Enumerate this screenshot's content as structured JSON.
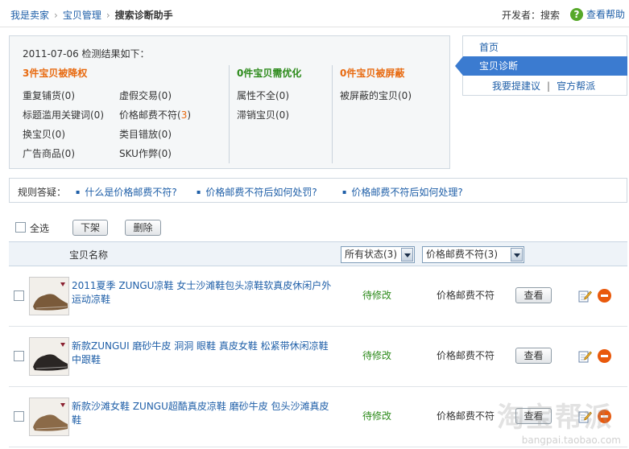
{
  "breadcrumb": {
    "home": "我是卖家",
    "section": "宝贝管理",
    "current": "搜索诊断助手"
  },
  "header": {
    "developer": "开发者：搜索",
    "help": "查看帮助"
  },
  "summary": {
    "title": "2011-07-06 检测结果如下：",
    "groups": [
      {
        "heading": "3件宝贝被降权",
        "color": "#e86a10",
        "items": [
          "重复铺货(0)",
          "虚假交易(0)",
          "标题滥用关键词(0)",
          "价格邮费不符(",
          "换宝贝(0)",
          "类目错放(0)",
          "广告商品(0)",
          "SKU作弊(0)"
        ],
        "highlight": {
          "count": "3",
          "close": ")"
        }
      },
      {
        "heading": "0件宝贝需优化",
        "color": "#2c8a1a",
        "items": [
          "属性不全(0)",
          "滞销宝贝(0)"
        ]
      },
      {
        "heading": "0件宝贝被屏蔽",
        "color": "#e86a10",
        "items": [
          "被屏蔽的宝贝(0)"
        ]
      }
    ]
  },
  "nav": {
    "home": "首页",
    "active": "宝贝诊断",
    "suggest": "我要提建议",
    "divider": "|",
    "forum": "官方帮派"
  },
  "rules": {
    "label": "规则答疑：",
    "links": [
      "什么是价格邮费不符?",
      "价格邮费不符后如何处罚?",
      "价格邮费不符后如何处理?"
    ]
  },
  "toolbar": {
    "select_all": "全选",
    "delist": "下架",
    "delete": "删除"
  },
  "table": {
    "col_name": "宝贝名称",
    "status_filter": "所有状态(3)",
    "reason_filter": "价格邮费不符(3)",
    "rows": [
      {
        "name": "2011夏季 ZUNGU凉鞋 女士沙滩鞋包头凉鞋软真皮休闲户外运动凉鞋",
        "status": "待修改",
        "reason": "价格邮费不符",
        "action": "查看",
        "shoe": "#7a5a3a"
      },
      {
        "name": "新款ZUNGUI 磨砂牛皮 洞洞 眼鞋 真皮女鞋 松紧带休闲凉鞋中跟鞋",
        "status": "待修改",
        "reason": "价格邮费不符",
        "action": "查看",
        "shoe": "#2a2624"
      },
      {
        "name": "新款沙滩女鞋 ZUNGU超酷真皮凉鞋 磨砂牛皮 包头沙滩真皮鞋",
        "status": "待修改",
        "reason": "价格邮费不符",
        "action": "查看",
        "shoe": "#8b6a48"
      }
    ]
  },
  "watermark": {
    "logo": "淘宝帮派",
    "url": "bangpai.taobao.com"
  }
}
